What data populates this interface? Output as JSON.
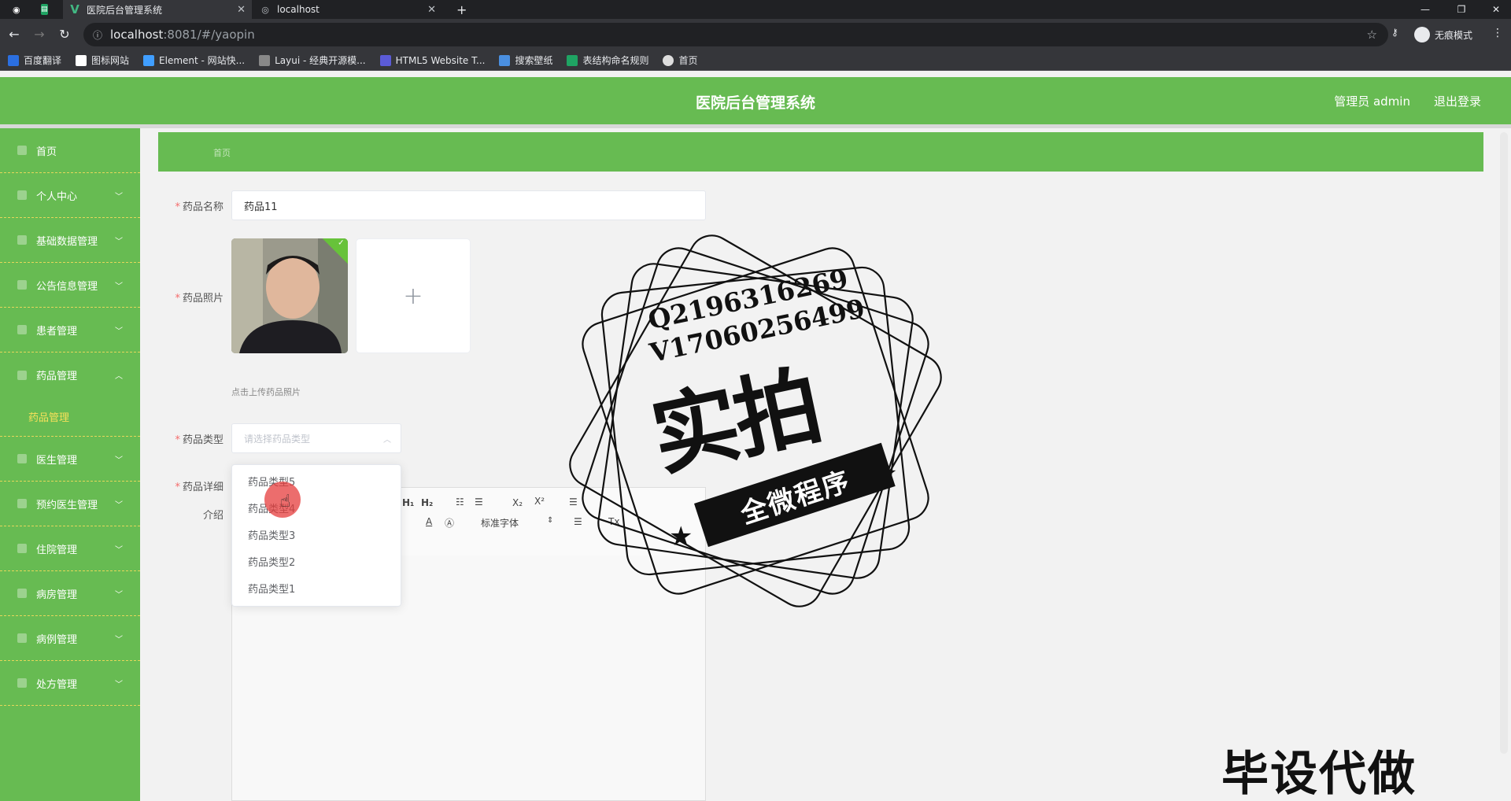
{
  "browser": {
    "tabs": [
      {
        "title": "医院后台管理系统",
        "icon": "vue-logo-icon"
      },
      {
        "title": "localhost",
        "icon": "globe-icon"
      }
    ],
    "url_host": "localhost",
    "url_path": ":8081/#/yaopin",
    "incognito_label": "无痕模式",
    "bookmarks": [
      "百度翻译",
      "图标网站",
      "Element - 网站快...",
      "Layui - 经典开源模...",
      "HTML5 Website T...",
      "搜索壁纸",
      "表结构命名规则",
      "首页"
    ]
  },
  "header": {
    "title": "医院后台管理系统",
    "user": "管理员 admin",
    "logout": "退出登录"
  },
  "sidebar": {
    "items": [
      {
        "label": "首页",
        "has_children": false
      },
      {
        "label": "个人中心",
        "has_children": true
      },
      {
        "label": "基础数据管理",
        "has_children": true
      },
      {
        "label": "公告信息管理",
        "has_children": true
      },
      {
        "label": "患者管理",
        "has_children": true
      },
      {
        "label": "药品管理",
        "has_children": true,
        "expanded": true
      },
      {
        "label": "医生管理",
        "has_children": true
      },
      {
        "label": "预约医生管理",
        "has_children": true
      },
      {
        "label": "住院管理",
        "has_children": true
      },
      {
        "label": "病房管理",
        "has_children": true
      },
      {
        "label": "病例管理",
        "has_children": true
      },
      {
        "label": "处方管理",
        "has_children": true
      }
    ],
    "subitem": "药品管理"
  },
  "breadcrumb": "首页",
  "form": {
    "name_label": "药品名称",
    "name_value": "药品11",
    "photo_label": "药品照片",
    "upload_tip": "点击上传药品照片",
    "type_label": "药品类型",
    "type_placeholder": "请选择药品类型",
    "detail_label_1": "药品详细",
    "detail_label_2": "介绍"
  },
  "dropdown": {
    "options": [
      "药品类型5",
      "药品类型4",
      "药品类型3",
      "药品类型2",
      "药品类型1"
    ]
  },
  "editor": {
    "font_select": "标准字体"
  },
  "watermark": {
    "line1": "Q2196316269",
    "line2": "V17060256499",
    "big": "实拍",
    "banner": "全微程序",
    "corner": "毕设代做"
  }
}
